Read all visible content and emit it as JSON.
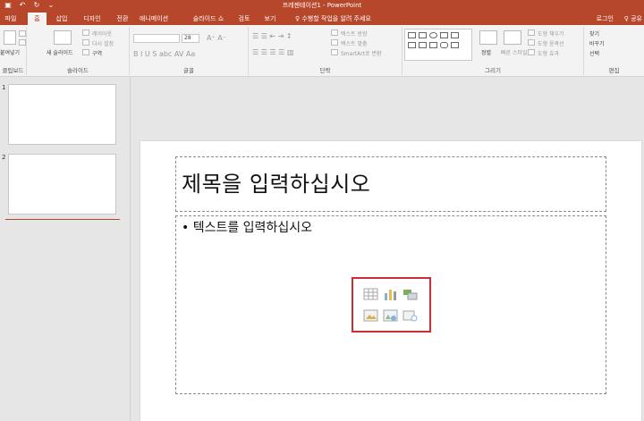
{
  "window": {
    "title": "프레젠테이션1 - PowerPoint"
  },
  "qat": {
    "save_icon": "save-icon",
    "undo_icon": "undo-icon",
    "redo_icon": "redo-icon",
    "customize_icon": "customize-icon"
  },
  "tabs": [
    {
      "label": "파일"
    },
    {
      "label": "홈"
    },
    {
      "label": "삽입"
    },
    {
      "label": "디자인"
    },
    {
      "label": "전환"
    },
    {
      "label": "애니메이션"
    },
    {
      "label": "슬라이드 쇼"
    },
    {
      "label": "검토"
    },
    {
      "label": "보기"
    }
  ],
  "tell_me": "♀ 수행할 작업을 알려 주세요",
  "account": {
    "login": "로그인",
    "share": "♀ 공유"
  },
  "ribbon": {
    "clipboard": {
      "paste": "붙여넣기",
      "label": "클립보드"
    },
    "slides": {
      "new_slide": "새 슬라이드",
      "layout": "레이아웃",
      "reset": "다시 설정",
      "section": "구역",
      "label": "슬라이드"
    },
    "font": {
      "font_size": "28",
      "label": "글꼴"
    },
    "paragraph": {
      "text_direction": "텍스트 방향",
      "align_text": "텍스트 맞춤",
      "smartart": "SmartArt로 변환",
      "label": "단락"
    },
    "drawing": {
      "arrange": "정렬",
      "quick_styles": "빠른 스타일",
      "fill": "도형 채우기",
      "outline": "도형 윤곽선",
      "effects": "도형 효과",
      "label": "그리기"
    },
    "editing": {
      "find": "찾기",
      "replace": "바꾸기",
      "select": "선택",
      "label": "편집"
    }
  },
  "thumbnails": [
    {
      "number": "1"
    },
    {
      "number": "2"
    }
  ],
  "slide": {
    "title_placeholder": "제목을 입력하십시오",
    "body_placeholder": "• 텍스트를 입력하십시오"
  },
  "colors": {
    "accent": "#b7472a",
    "highlight": "#cf2d36"
  }
}
